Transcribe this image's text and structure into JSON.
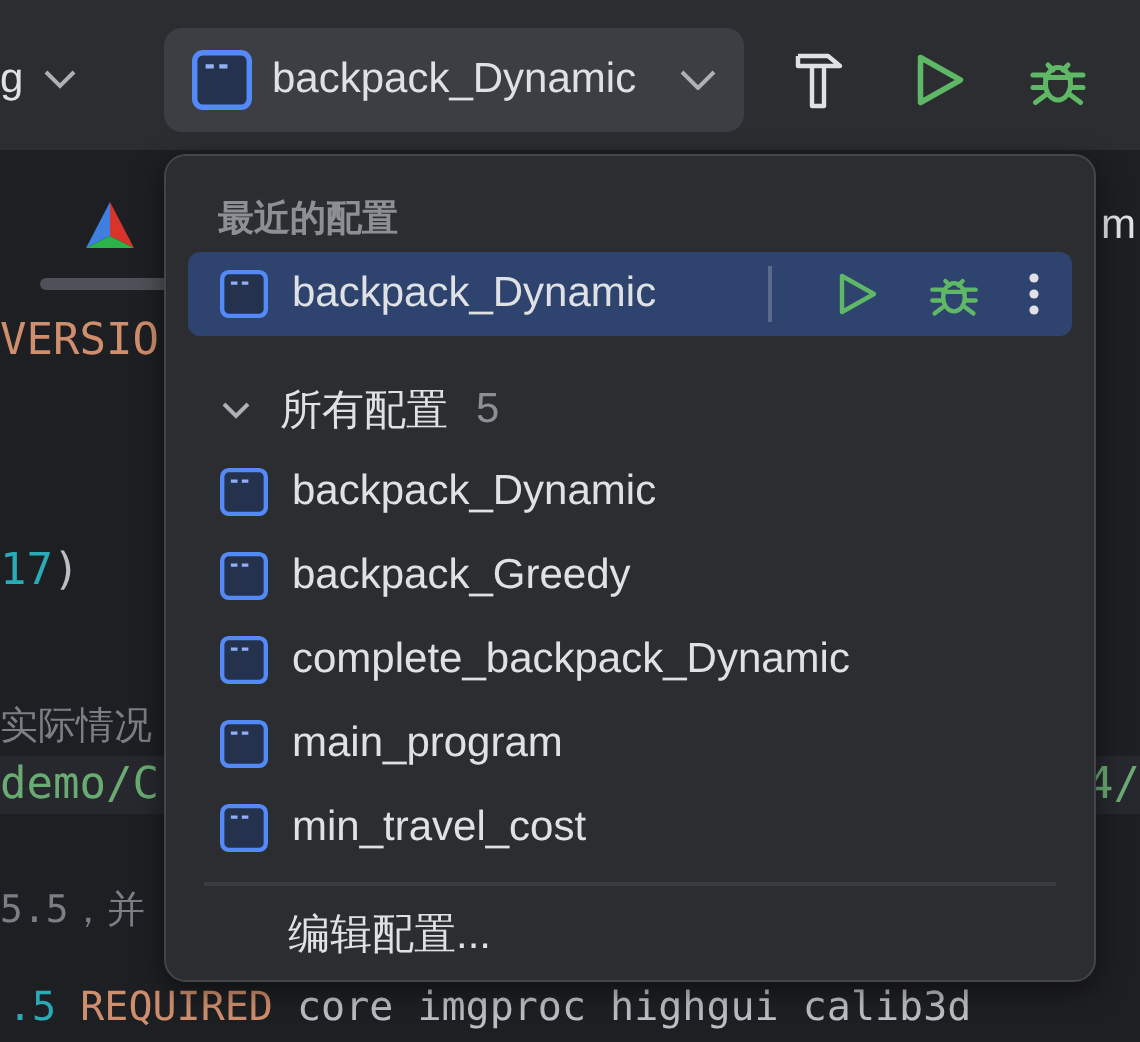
{
  "toolbar": {
    "build_config": "g",
    "run_config": "backpack_Dynamic"
  },
  "tabs": [
    {
      "label": "m"
    }
  ],
  "editor_lines": [
    {
      "left": [
        {
          "text": "VERSIO",
          "kind": "keyword"
        }
      ]
    },
    {
      "left": [
        {
          "text": "17",
          "kind": "number"
        },
        {
          "text": ")",
          "kind": "plain"
        }
      ]
    },
    {
      "left": [
        {
          "text": "实际情况",
          "kind": "comment"
        }
      ]
    },
    {
      "left": [
        {
          "text": "demo/C",
          "kind": "string"
        }
      ],
      "right": [
        {
          "text": "4/",
          "kind": "string"
        }
      ],
      "highlighted": true
    },
    {
      "left": [
        {
          "text": "5.5，并",
          "kind": "comment"
        }
      ]
    },
    {
      "left": [
        {
          "text": ".5",
          "kind": "number"
        },
        {
          "text": " REQUIRED",
          "kind": "keyword"
        },
        {
          "text": " core imgproc highgui calib3d",
          "kind": "plain"
        }
      ]
    }
  ],
  "popup": {
    "recent_header": "最近的配置",
    "recent": [
      {
        "label": "backpack_Dynamic",
        "selected": true
      }
    ],
    "all_header": "所有配置",
    "all_count": "5",
    "all_expanded": true,
    "items": [
      {
        "label": "backpack_Dynamic",
        "selected": false
      },
      {
        "label": "backpack_Greedy",
        "selected": false
      },
      {
        "label": "complete_backpack_Dynamic",
        "selected": false
      },
      {
        "label": "main_program",
        "selected": false
      },
      {
        "label": "min_travel_cost",
        "selected": false
      }
    ],
    "edit": "编辑配置..."
  }
}
